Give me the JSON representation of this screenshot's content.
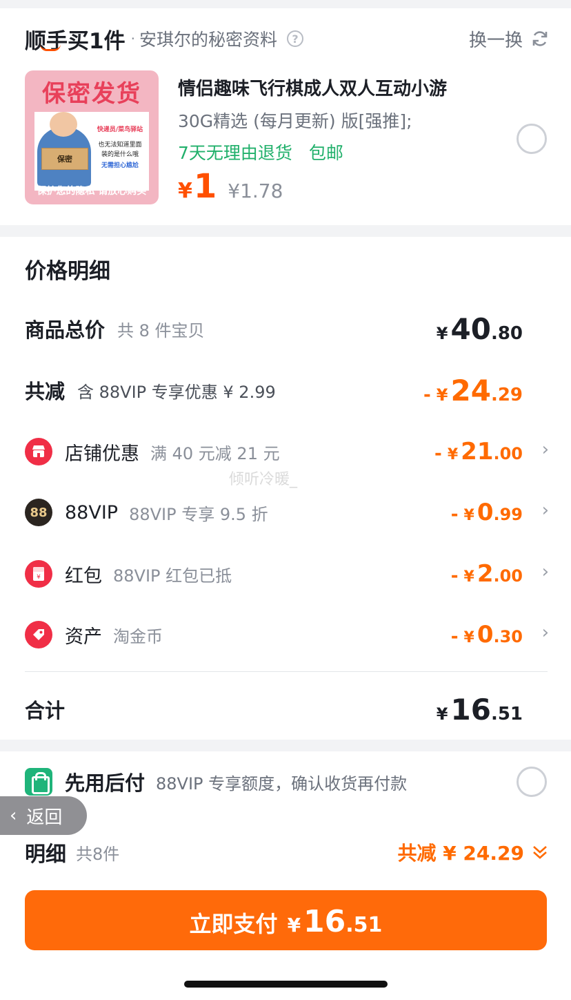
{
  "top": {
    "logo": "顺手买1件",
    "dot": "·",
    "subtitle": "安琪尔的秘密资料",
    "swap_label": "换一换",
    "product": {
      "image_title": "保密发货",
      "image_note_1": "快递员/菜鸟驿站",
      "image_note_2": "也无法知道里面",
      "image_note_3": "装的是什么哦",
      "image_note_4": "无需担心尴尬",
      "image_box": "保密",
      "image_bottom": "保护您的隐私 请放心购买",
      "title": "情侣趣味飞行棋成人双人互动小游",
      "spec": "30G精选 (每月更新) 版[强推];",
      "tags": [
        "7天无理由退货",
        "包邮"
      ],
      "price_currency": "¥",
      "price": "1",
      "original_price": "¥1.78"
    }
  },
  "detail": {
    "title": "价格明细",
    "total": {
      "label": "商品总价",
      "sub": "共 8 件宝贝",
      "currency": "¥",
      "int": "40",
      "dec": ".80"
    },
    "discount": {
      "label": "共减",
      "sub": "含 88VIP 专享优惠 ¥ 2.99",
      "minus": "-",
      "currency": "¥",
      "int": "24",
      "dec": ".29"
    },
    "items": [
      {
        "label": "店铺优惠",
        "sub": "满 40 元减 21 元",
        "minus": "-",
        "currency": "¥",
        "int": "21",
        "dec": ".00",
        "icon": "shop-icon"
      },
      {
        "label": "88VIP",
        "sub": "88VIP 专享 9.5 折",
        "minus": "-",
        "currency": "¥",
        "int": "0",
        "dec": ".99",
        "icon": "vip-88-icon",
        "icon_text": "88"
      },
      {
        "label": "红包",
        "sub": "88VIP 红包已抵",
        "minus": "-",
        "currency": "¥",
        "int": "2",
        "dec": ".00",
        "icon": "red-packet-icon"
      },
      {
        "label": "资产",
        "sub": "淘金币",
        "minus": "-",
        "currency": "¥",
        "int": "0",
        "dec": ".30",
        "icon": "coin-tag-icon"
      }
    ],
    "sum": {
      "label": "合计",
      "currency": "¥",
      "int": "16",
      "dec": ".51"
    },
    "watermark": "倾听冷暖_"
  },
  "bottom": {
    "pay_later": {
      "label": "先用后付",
      "sub": "88VIP 专享额度，确认收货再付款"
    },
    "back_label": "返回",
    "detail_label": "明细",
    "detail_count": "共8件",
    "detail_discount": "共减 ¥ 24.29",
    "pay_button": {
      "label": "立即支付",
      "currency": "¥",
      "int": "16",
      "dec": ".51"
    }
  },
  "colors": {
    "accent": "#ff6a00",
    "green": "#21b06b",
    "red_icon": "#f02e46"
  }
}
